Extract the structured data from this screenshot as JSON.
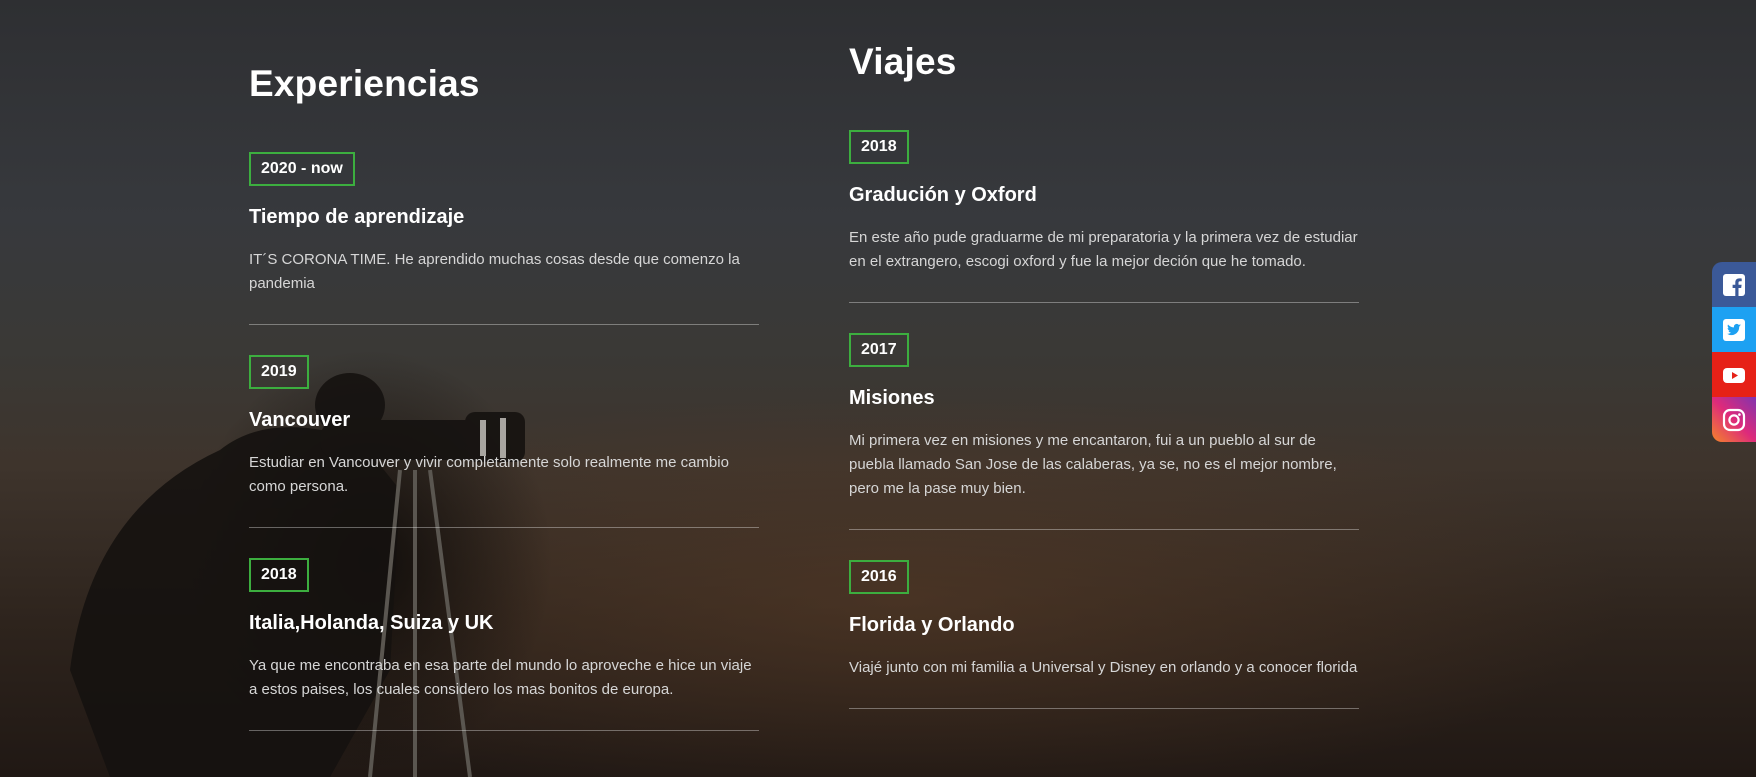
{
  "experiencias": {
    "title": "Experiencias",
    "entries": [
      {
        "year": "2020 - now",
        "title": "Tiempo de aprendizaje",
        "text": "IT´S CORONA TIME. He aprendido muchas cosas desde que comenzo la pandemia"
      },
      {
        "year": "2019",
        "title": "Vancouver",
        "text": "Estudiar en Vancouver y vivir completamente solo realmente me cambio como persona."
      },
      {
        "year": "2018",
        "title": "Italia,Holanda, Suiza y UK",
        "text": "Ya que me encontraba en esa parte del mundo lo aproveche e hice un viaje a estos paises, los cuales considero los mas bonitos de europa."
      }
    ]
  },
  "viajes": {
    "title": "Viajes",
    "entries": [
      {
        "year": "2018",
        "title": "Gradución y Oxford",
        "text": "En este año pude graduarme de mi preparatoria y la primera vez de estudiar en el extrangero, escogi oxford y fue la mejor deción que he tomado."
      },
      {
        "year": "2017",
        "title": "Misiones",
        "text": "Mi primera vez en misiones y me encantaron, fui a un pueblo al sur de puebla llamado San Jose de las calaberas, ya se, no es el mejor nombre, pero me la pase muy bien."
      },
      {
        "year": "2016",
        "title": "Florida y Orlando",
        "text": "Viajé junto con mi familia a Universal y Disney en orlando y a conocer florida"
      }
    ]
  },
  "social": [
    {
      "icon": "facebook-icon",
      "color": "#3b5998"
    },
    {
      "icon": "twitter-icon",
      "color": "#1da1f2"
    },
    {
      "icon": "youtube-icon",
      "color": "#e62117"
    },
    {
      "icon": "instagram-icon",
      "color": "#c13584"
    }
  ],
  "colors": {
    "badge_border": "#3cae3f",
    "divider": "rgba(255,255,255,0.35)"
  }
}
